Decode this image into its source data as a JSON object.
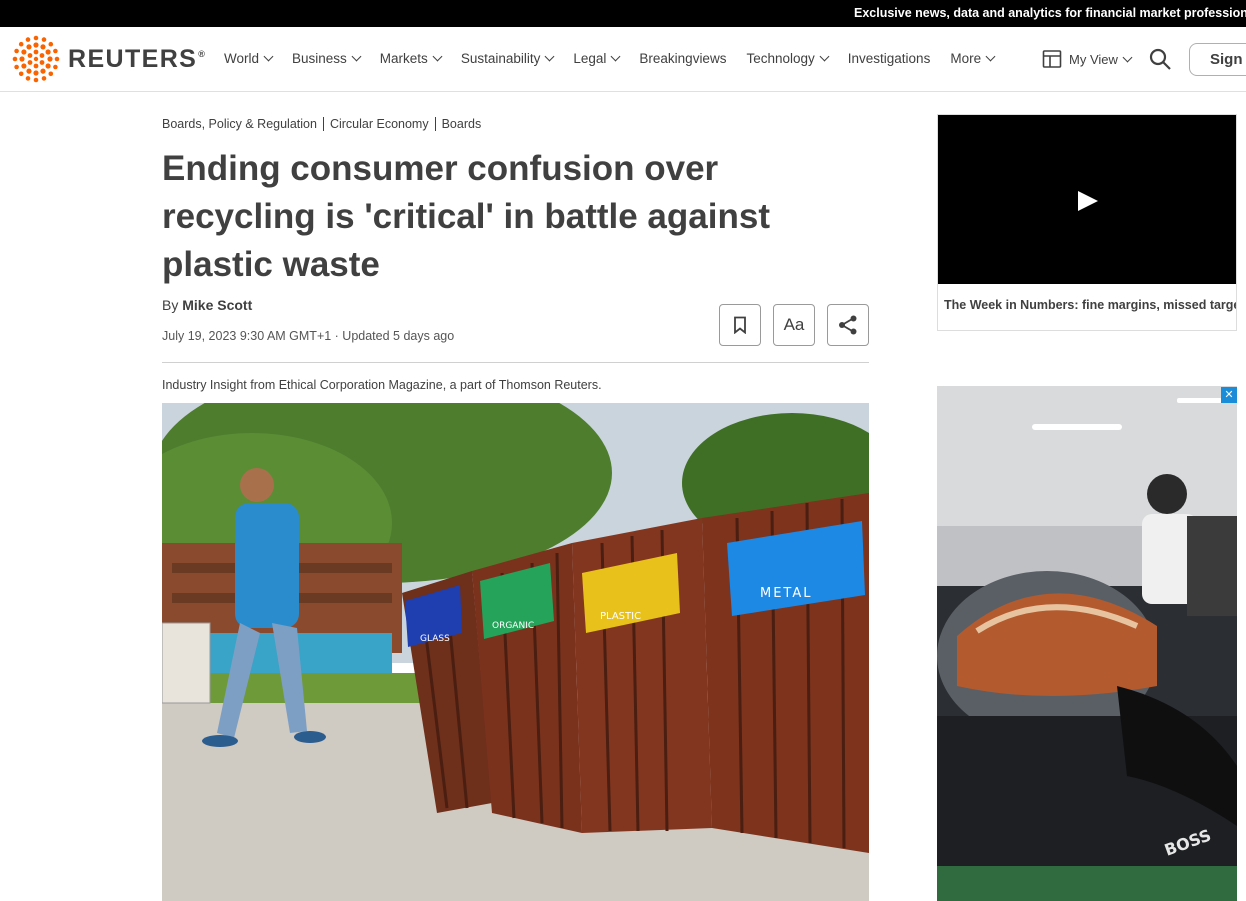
{
  "topbar": {
    "promo": "Exclusive news, data and analytics for financial market professionals"
  },
  "brand": {
    "name": "REUTERS",
    "mark": "®",
    "color": "#fa6400"
  },
  "nav": {
    "items": [
      {
        "label": "World",
        "dropdown": true
      },
      {
        "label": "Business",
        "dropdown": true
      },
      {
        "label": "Markets",
        "dropdown": true
      },
      {
        "label": "Sustainability",
        "dropdown": true
      },
      {
        "label": "Legal",
        "dropdown": true
      },
      {
        "label": "Breakingviews",
        "dropdown": false
      },
      {
        "label": "Technology",
        "dropdown": true
      },
      {
        "label": "Investigations",
        "dropdown": false
      },
      {
        "label": "More",
        "dropdown": true
      }
    ],
    "my_view": "My View",
    "sign_in": "Sign In"
  },
  "article": {
    "breadcrumbs": [
      "Boards, Policy & Regulation",
      "Circular Economy",
      "Boards"
    ],
    "headline": "Ending consumer confusion over recycling is 'critical' in battle against plastic waste",
    "by": "By",
    "author": "Mike Scott",
    "dateline": "July 19, 2023 9:30 AM GMT+1 · Updated 5 days ago",
    "font_button": "Aa",
    "insight": "Industry Insight from Ethical Corporation Magazine, a part of Thomson Reuters.",
    "bins": [
      "GLASS",
      "ORGANIC",
      "PLASTIC",
      "METAL"
    ],
    "bin_colors": [
      "#1f3fb0",
      "#25a35a",
      "#e8c21a",
      "#1e88e5"
    ]
  },
  "sidebar": {
    "video_caption": "The Week in Numbers: fine margins, missed targets"
  },
  "ad": {
    "close": "✕",
    "brand_text": "BOSS"
  }
}
